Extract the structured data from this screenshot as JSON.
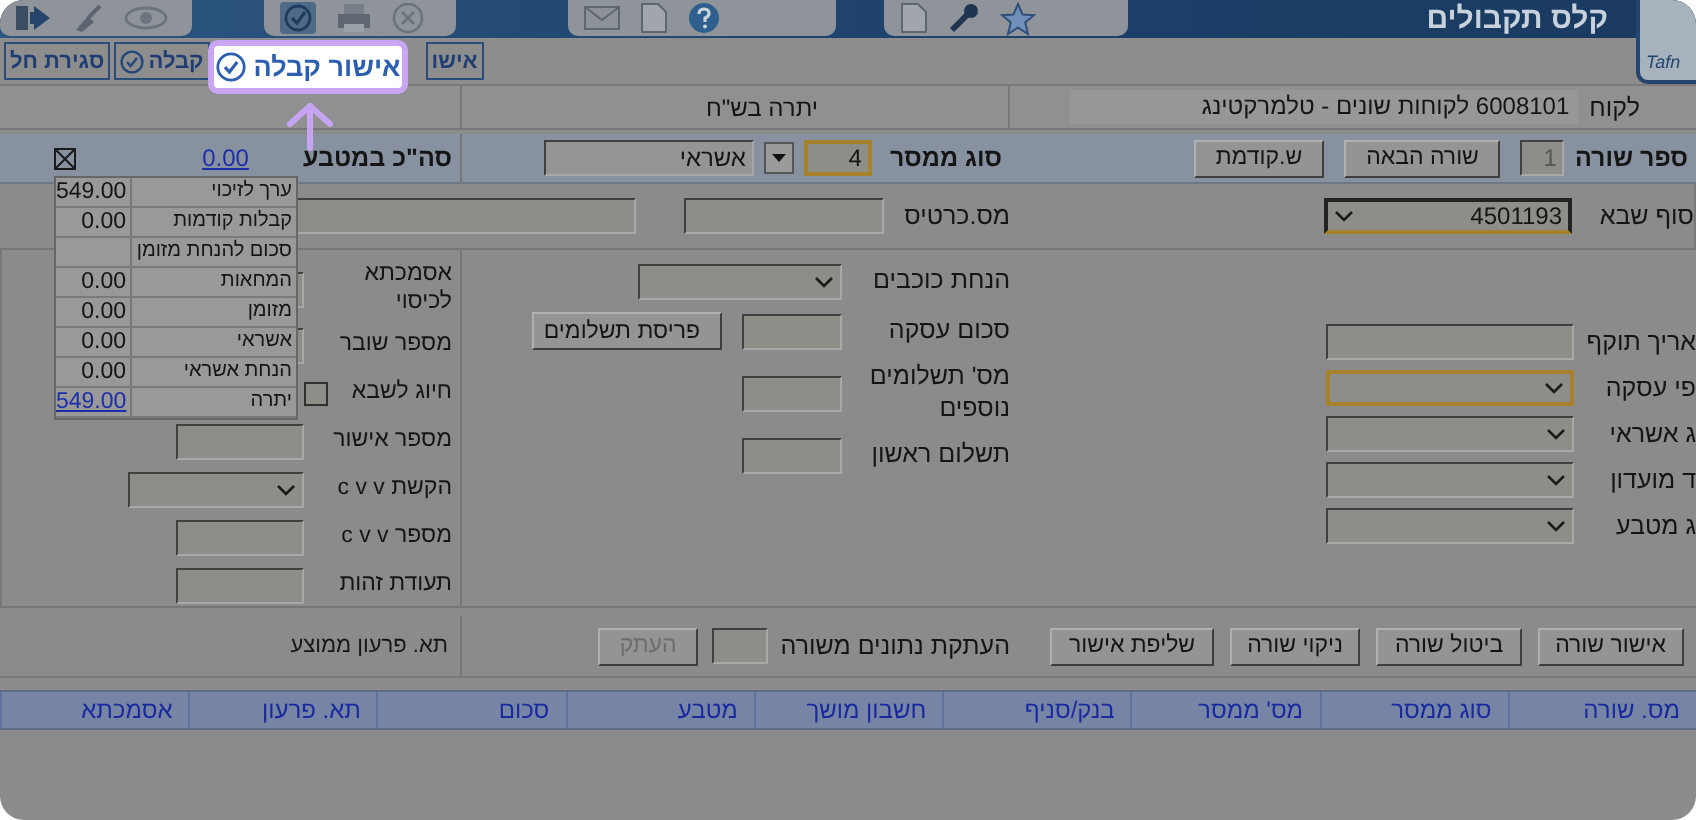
{
  "toolbar_title": "קלס תקבולים",
  "logo": "Tafn",
  "tabs": [
    {
      "label": "אישו",
      "icon": false
    },
    {
      "label": "קבלה",
      "icon": true
    },
    {
      "label": "סגירת חל",
      "icon": false
    }
  ],
  "callout": {
    "label": "אישור קבלה"
  },
  "customer": {
    "label": "לקוח",
    "value": "6008101 לקוחות שונים - טלמרקטינג"
  },
  "balance_heading": "יתרה בש\"ח",
  "line_bar": {
    "label": "ספר שורה",
    "line_number": "1",
    "buttons": [
      "שורה הבאה",
      "ש.קודמת"
    ],
    "relay_label": "סוג ממסר",
    "relay_code": "4",
    "relay_code_focused": true,
    "relay_type": "אשראי",
    "total_label": "סה\"כ במטבע",
    "total_value": "0.00"
  },
  "card_row": {
    "terminal_label": "סוף שבא",
    "terminal_value": "4501193",
    "card_label": "מס.כרטיס"
  },
  "right_fields": [
    {
      "kind": "input",
      "label": "אריך תוקף",
      "focused": false
    },
    {
      "kind": "select",
      "label": "פי עסקה",
      "focused": true
    },
    {
      "kind": "select",
      "label": "ג אשראי",
      "focused": false
    },
    {
      "kind": "select",
      "label": "ד מועדון",
      "focused": false
    },
    {
      "kind": "select",
      "label": "ג מטבע",
      "focused": false
    }
  ],
  "middle_fields": [
    {
      "kind": "select",
      "label": "הנחת כוכבים"
    },
    {
      "kind": "input",
      "label": "סכום עסקה",
      "button": "פריסת תשלומים"
    },
    {
      "kind": "input",
      "label": "מס' תשלומים נוספים"
    },
    {
      "kind": "input",
      "label": "תשלום ראשון"
    }
  ],
  "left_fields": [
    {
      "kind": "input",
      "label": "אסמכתא לכיסוי"
    },
    {
      "kind": "input",
      "label": "מספר שובר"
    },
    {
      "kind": "checkbox",
      "label": "חיוג לשבא",
      "checked": false
    },
    {
      "kind": "input",
      "label": "מספר אישור"
    },
    {
      "kind": "select",
      "label": "הקשת c v v"
    },
    {
      "kind": "input",
      "label": "מספר c v v"
    },
    {
      "kind": "input",
      "label": "תעודת זהות"
    }
  ],
  "summary": [
    {
      "label": "ערך לזיכוי",
      "value": "549.00",
      "link": false
    },
    {
      "label": "קבלות קודמות",
      "value": "0.00",
      "link": false
    },
    {
      "label": "סכום להנחת מזומן"
    },
    {
      "label": "המחאות",
      "value": "0.00",
      "link": false
    },
    {
      "label": "מזומן",
      "value": "0.00",
      "link": false
    },
    {
      "label": "אשראי",
      "value": "0.00",
      "link": false
    },
    {
      "label": "הנחת אשראי",
      "value": "0.00",
      "link": false
    },
    {
      "label": "יתרה",
      "value": "549.00",
      "link": true
    }
  ],
  "line_buttons": [
    "אישור שורה",
    "ביטול שורה",
    "ניקוי שורה",
    "שליפת אישור"
  ],
  "copy": {
    "label": "העתקת נתונים משורה",
    "button": "העתק",
    "button_disabled": true
  },
  "average_due_label": "תא. פרעון ממוצע",
  "table": {
    "columns": [
      "מס. שורה",
      "סוג ממסר",
      "מס' ממסר",
      "בנק/סניף",
      "חשבון מושך",
      "מטבע",
      "סכום",
      "תא. פרעון",
      "אסמכתא"
    ]
  }
}
